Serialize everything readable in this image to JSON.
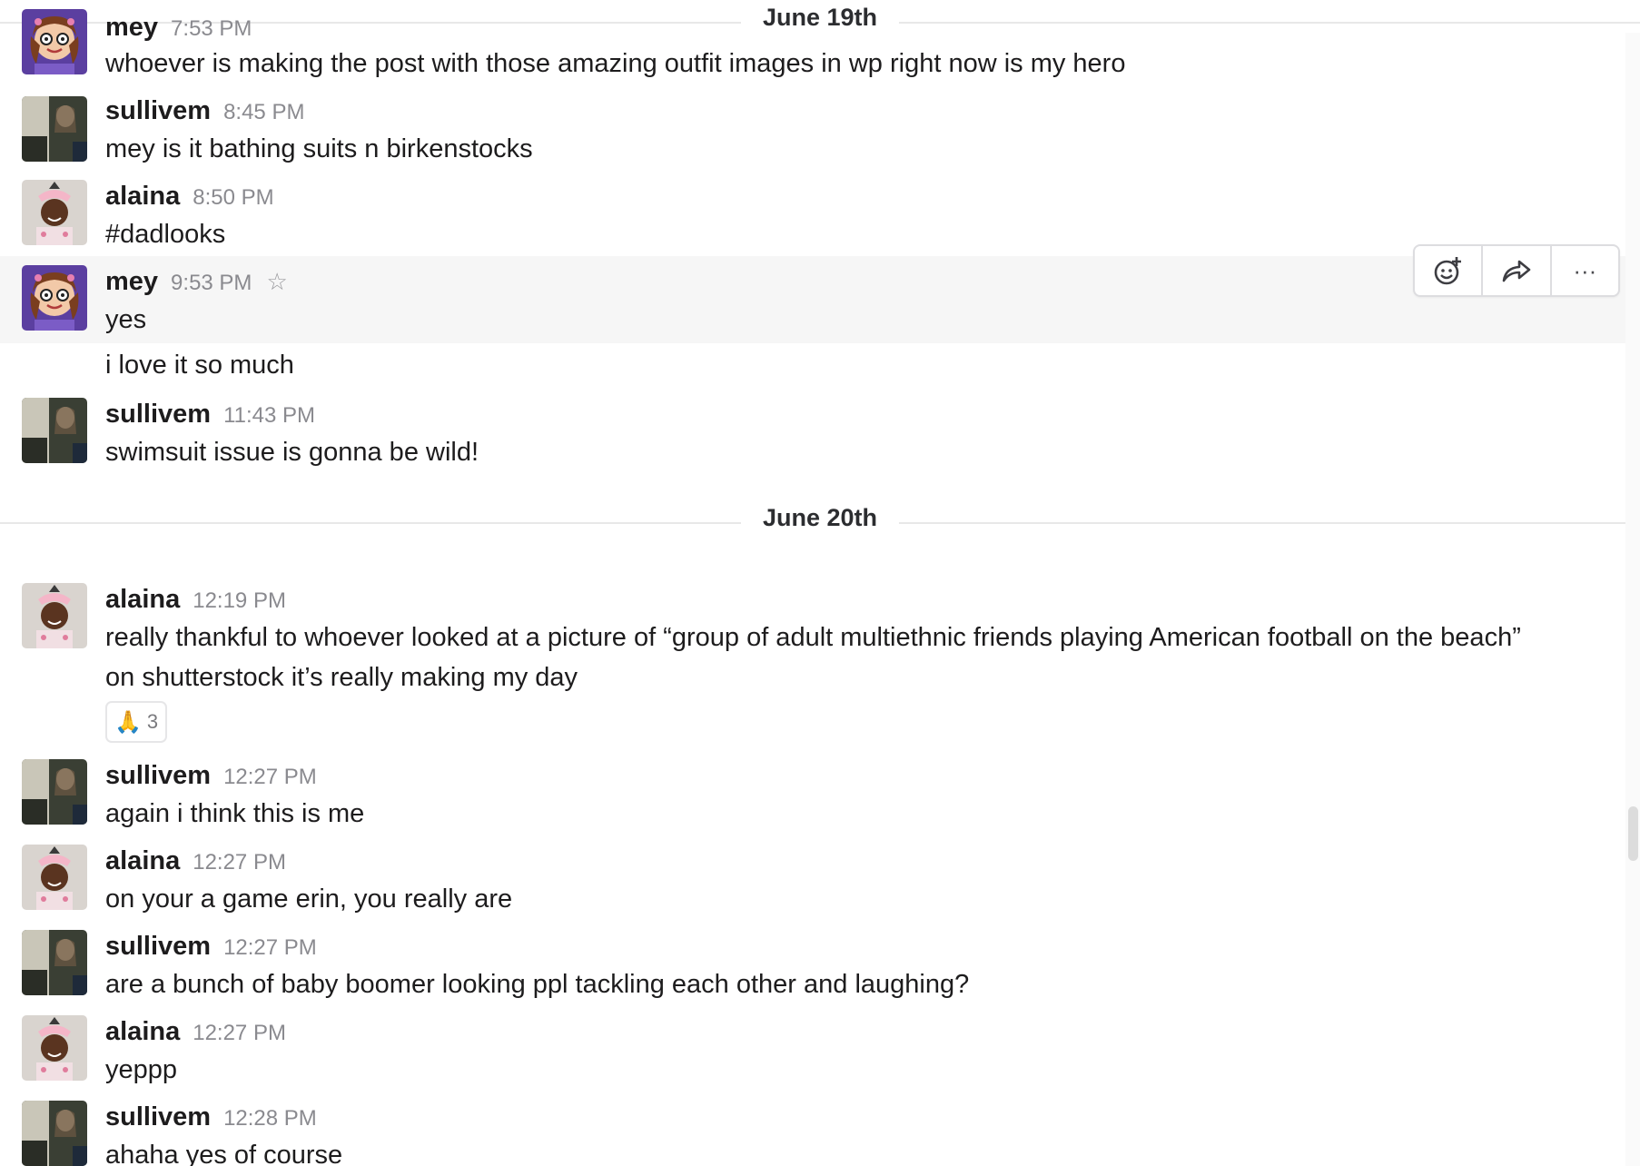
{
  "days": [
    {
      "label": "June 19th"
    },
    {
      "label": "June 20th"
    }
  ],
  "messages": [
    {
      "author": "mey",
      "time": "7:53 PM",
      "text": "whoever is making the post with those amazing outfit images in wp right now is my hero"
    },
    {
      "author": "sullivem",
      "time": "8:45 PM",
      "text": "mey is it bathing suits n birkenstocks"
    },
    {
      "author": "alaina",
      "time": "8:50 PM",
      "text": "#dadlooks"
    },
    {
      "author": "mey",
      "time": "9:53 PM",
      "text": "yes",
      "star_icon": "star-outline-icon"
    },
    {
      "text": "i love it so much"
    },
    {
      "author": "sullivem",
      "time": "11:43 PM",
      "text": "swimsuit issue is gonna be wild!"
    },
    {
      "author": "alaina",
      "time": "12:19 PM",
      "text": "really thankful to whoever looked at a picture of “group of adult multiethnic friends playing American football on the beach” on shutterstock it’s really making my day",
      "reaction": {
        "emoji": "🙏",
        "count": "3"
      }
    },
    {
      "author": "sullivem",
      "time": "12:27 PM",
      "text": "again i think this is me"
    },
    {
      "author": "alaina",
      "time": "12:27 PM",
      "text": "on your a game erin, you really are"
    },
    {
      "author": "sullivem",
      "time": "12:27 PM",
      "text": "are a bunch of baby boomer looking ppl tackling each other and laughing?"
    },
    {
      "author": "alaina",
      "time": "12:27 PM",
      "text": "yeppp"
    },
    {
      "author": "sullivem",
      "time": "12:28 PM",
      "text": "ahaha yes of course"
    }
  ],
  "hover_actions": {
    "icons": [
      "add-reaction-icon",
      "share-icon",
      "more-actions-icon"
    ],
    "more_glyph": "···"
  },
  "colors": {
    "hover_bg": "#f6f6f6",
    "divider": "#e8e8e8",
    "timestamp": "#8a8a8f",
    "mey_avatar_bg": "#5b3fa0",
    "alaina_avatar_bg": "#d9d4cf",
    "sullivem_avatar_bg": "#3a3f34"
  }
}
